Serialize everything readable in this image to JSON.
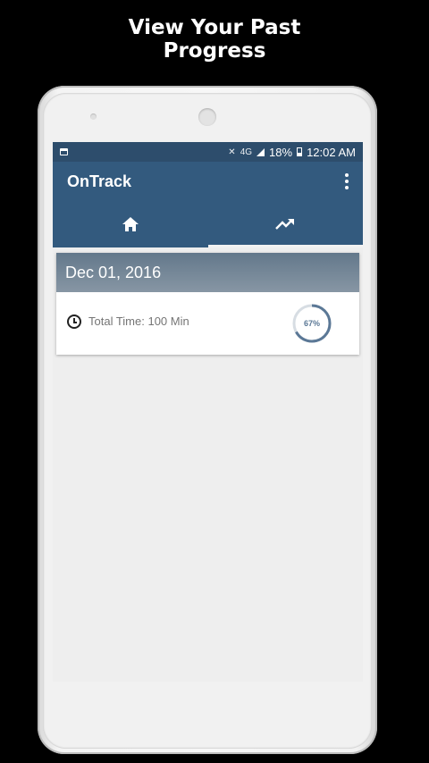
{
  "promo": {
    "line1": "View Your Past",
    "line2": "Progress"
  },
  "status_bar": {
    "network": "4G",
    "battery": "18%",
    "time": "12:02 AM"
  },
  "app_bar": {
    "title": "OnTrack"
  },
  "tabs": [
    {
      "icon": "home-icon",
      "active": true
    },
    {
      "icon": "trending-up-icon",
      "active": false
    }
  ],
  "card": {
    "date": "Dec 01, 2016",
    "total_time": "Total Time: 100 Min",
    "progress_label": "67%",
    "progress_value": 0.67
  },
  "colors": {
    "primary": "#335a7e",
    "status_bar": "#2d4d6c",
    "card_header": "#6f8293",
    "ring": "#5b7896"
  }
}
